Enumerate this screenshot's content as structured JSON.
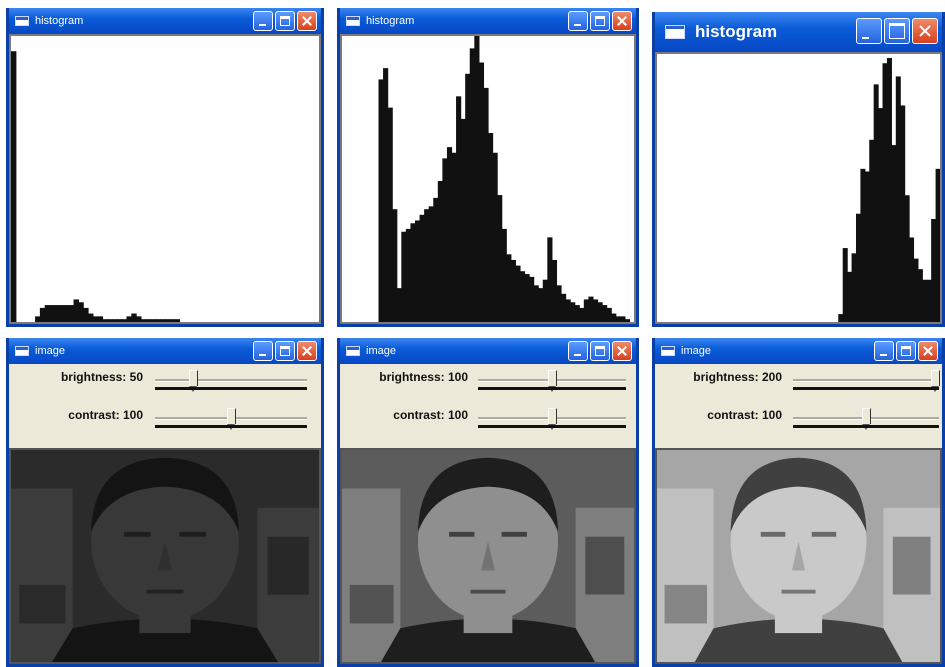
{
  "histogram_windows": [
    {
      "title": "histogram",
      "bins": [
        96,
        0,
        0,
        0,
        0,
        2,
        5,
        6,
        6,
        6,
        6,
        6,
        6,
        8,
        7,
        5,
        3,
        2,
        2,
        1,
        1,
        1,
        1,
        1,
        2,
        3,
        2,
        1,
        1,
        1,
        1,
        1,
        1,
        1,
        1,
        0,
        0,
        0,
        0,
        0,
        0,
        0,
        0,
        0,
        0,
        0,
        0,
        0,
        0,
        0,
        0,
        0,
        0,
        0,
        0,
        0,
        0,
        0,
        0,
        0,
        0,
        0,
        0,
        0
      ]
    },
    {
      "title": "histogram",
      "bins": [
        0,
        0,
        0,
        0,
        0,
        0,
        0,
        0,
        86,
        90,
        76,
        40,
        12,
        32,
        33,
        35,
        36,
        38,
        40,
        41,
        44,
        50,
        58,
        62,
        60,
        80,
        72,
        88,
        97,
        104,
        92,
        83,
        67,
        60,
        45,
        33,
        24,
        22,
        20,
        18,
        17,
        16,
        13,
        12,
        15,
        30,
        22,
        13,
        10,
        8,
        7,
        6,
        5,
        8,
        9,
        8,
        7,
        6,
        5,
        3,
        2,
        2,
        1,
        0
      ]
    },
    {
      "title": "histogram",
      "bins": [
        0,
        0,
        0,
        0,
        0,
        0,
        0,
        0,
        0,
        0,
        0,
        0,
        0,
        0,
        0,
        0,
        0,
        0,
        0,
        0,
        0,
        0,
        0,
        0,
        0,
        0,
        0,
        0,
        0,
        0,
        0,
        0,
        0,
        0,
        0,
        0,
        0,
        0,
        0,
        0,
        0,
        3,
        28,
        19,
        26,
        41,
        58,
        57,
        69,
        90,
        81,
        98,
        100,
        67,
        93,
        82,
        48,
        32,
        24,
        20,
        16,
        16,
        39,
        58
      ]
    }
  ],
  "image_windows": [
    {
      "title": "image",
      "brightness_label": "brightness: 50",
      "contrast_label": "contrast: 100",
      "brightness_pct": 0.25,
      "contrast_pct": 0.5
    },
    {
      "title": "image",
      "brightness_label": "brightness: 100",
      "contrast_label": "contrast: 100",
      "brightness_pct": 0.5,
      "contrast_pct": 0.5
    },
    {
      "title": "image",
      "brightness_label": "brightness: 200",
      "contrast_label": "contrast: 100",
      "brightness_pct": 1.0,
      "contrast_pct": 0.5
    }
  ],
  "colors": {
    "titlebar": "#0a5cd8",
    "histogram_bar": "#111111"
  },
  "photo_tones": [
    {
      "bg": "#2b2b2b",
      "face": "#383838",
      "hair": "#141414",
      "wall": "#3c3c3c"
    },
    {
      "bg": "#5c5c5c",
      "face": "#8f8f8f",
      "hair": "#1e1e1e",
      "wall": "#7e7e7e"
    },
    {
      "bg": "#a6a6a6",
      "face": "#c9c9c9",
      "hair": "#404040",
      "wall": "#c0c0c0"
    }
  ]
}
